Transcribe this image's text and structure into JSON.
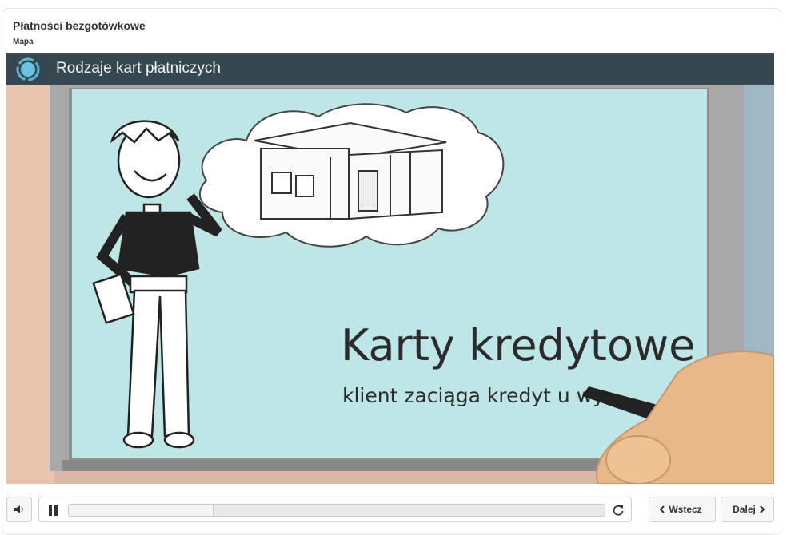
{
  "page": {
    "title": "Płatności bezgotówkowe",
    "subtitle": "Mapa"
  },
  "video": {
    "title": "Rodzaje kart płatniczych",
    "headline": "Karty kredytowe",
    "caption": "klient zaciąga kredyt u wy",
    "progress": 0.27
  },
  "controls": {
    "volume_icon": "volume-icon",
    "pause_icon": "pause-icon",
    "replay_icon": "replay-icon",
    "back_label": "Wstecz",
    "next_label": "Dalej"
  },
  "colors": {
    "header_bg": "#37474f",
    "board_bg": "#bfe6e6",
    "logo": "#5ab4d6"
  }
}
